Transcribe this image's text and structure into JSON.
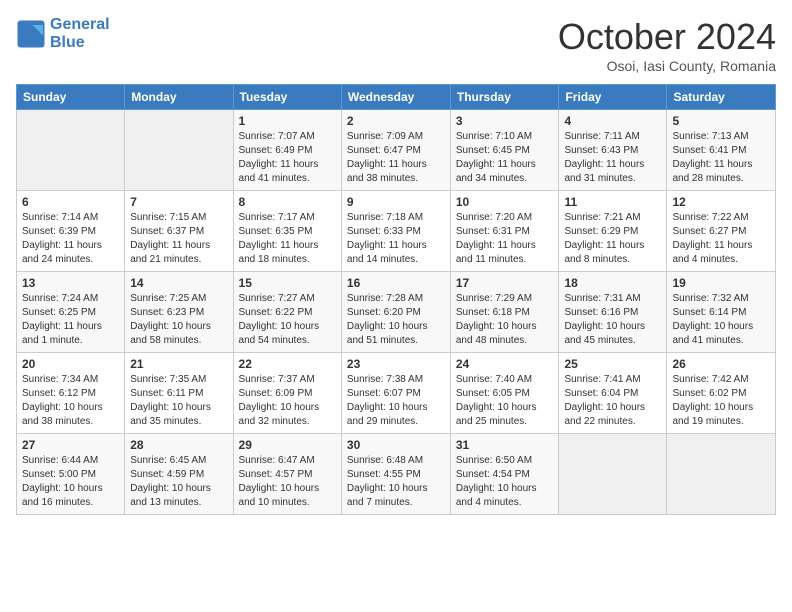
{
  "header": {
    "logo_line1": "General",
    "logo_line2": "Blue",
    "month": "October 2024",
    "location": "Osoi, Iasi County, Romania"
  },
  "weekdays": [
    "Sunday",
    "Monday",
    "Tuesday",
    "Wednesday",
    "Thursday",
    "Friday",
    "Saturday"
  ],
  "weeks": [
    [
      {
        "day": "",
        "info": ""
      },
      {
        "day": "",
        "info": ""
      },
      {
        "day": "1",
        "info": "Sunrise: 7:07 AM\nSunset: 6:49 PM\nDaylight: 11 hours and 41 minutes."
      },
      {
        "day": "2",
        "info": "Sunrise: 7:09 AM\nSunset: 6:47 PM\nDaylight: 11 hours and 38 minutes."
      },
      {
        "day": "3",
        "info": "Sunrise: 7:10 AM\nSunset: 6:45 PM\nDaylight: 11 hours and 34 minutes."
      },
      {
        "day": "4",
        "info": "Sunrise: 7:11 AM\nSunset: 6:43 PM\nDaylight: 11 hours and 31 minutes."
      },
      {
        "day": "5",
        "info": "Sunrise: 7:13 AM\nSunset: 6:41 PM\nDaylight: 11 hours and 28 minutes."
      }
    ],
    [
      {
        "day": "6",
        "info": "Sunrise: 7:14 AM\nSunset: 6:39 PM\nDaylight: 11 hours and 24 minutes."
      },
      {
        "day": "7",
        "info": "Sunrise: 7:15 AM\nSunset: 6:37 PM\nDaylight: 11 hours and 21 minutes."
      },
      {
        "day": "8",
        "info": "Sunrise: 7:17 AM\nSunset: 6:35 PM\nDaylight: 11 hours and 18 minutes."
      },
      {
        "day": "9",
        "info": "Sunrise: 7:18 AM\nSunset: 6:33 PM\nDaylight: 11 hours and 14 minutes."
      },
      {
        "day": "10",
        "info": "Sunrise: 7:20 AM\nSunset: 6:31 PM\nDaylight: 11 hours and 11 minutes."
      },
      {
        "day": "11",
        "info": "Sunrise: 7:21 AM\nSunset: 6:29 PM\nDaylight: 11 hours and 8 minutes."
      },
      {
        "day": "12",
        "info": "Sunrise: 7:22 AM\nSunset: 6:27 PM\nDaylight: 11 hours and 4 minutes."
      }
    ],
    [
      {
        "day": "13",
        "info": "Sunrise: 7:24 AM\nSunset: 6:25 PM\nDaylight: 11 hours and 1 minute."
      },
      {
        "day": "14",
        "info": "Sunrise: 7:25 AM\nSunset: 6:23 PM\nDaylight: 10 hours and 58 minutes."
      },
      {
        "day": "15",
        "info": "Sunrise: 7:27 AM\nSunset: 6:22 PM\nDaylight: 10 hours and 54 minutes."
      },
      {
        "day": "16",
        "info": "Sunrise: 7:28 AM\nSunset: 6:20 PM\nDaylight: 10 hours and 51 minutes."
      },
      {
        "day": "17",
        "info": "Sunrise: 7:29 AM\nSunset: 6:18 PM\nDaylight: 10 hours and 48 minutes."
      },
      {
        "day": "18",
        "info": "Sunrise: 7:31 AM\nSunset: 6:16 PM\nDaylight: 10 hours and 45 minutes."
      },
      {
        "day": "19",
        "info": "Sunrise: 7:32 AM\nSunset: 6:14 PM\nDaylight: 10 hours and 41 minutes."
      }
    ],
    [
      {
        "day": "20",
        "info": "Sunrise: 7:34 AM\nSunset: 6:12 PM\nDaylight: 10 hours and 38 minutes."
      },
      {
        "day": "21",
        "info": "Sunrise: 7:35 AM\nSunset: 6:11 PM\nDaylight: 10 hours and 35 minutes."
      },
      {
        "day": "22",
        "info": "Sunrise: 7:37 AM\nSunset: 6:09 PM\nDaylight: 10 hours and 32 minutes."
      },
      {
        "day": "23",
        "info": "Sunrise: 7:38 AM\nSunset: 6:07 PM\nDaylight: 10 hours and 29 minutes."
      },
      {
        "day": "24",
        "info": "Sunrise: 7:40 AM\nSunset: 6:05 PM\nDaylight: 10 hours and 25 minutes."
      },
      {
        "day": "25",
        "info": "Sunrise: 7:41 AM\nSunset: 6:04 PM\nDaylight: 10 hours and 22 minutes."
      },
      {
        "day": "26",
        "info": "Sunrise: 7:42 AM\nSunset: 6:02 PM\nDaylight: 10 hours and 19 minutes."
      }
    ],
    [
      {
        "day": "27",
        "info": "Sunrise: 6:44 AM\nSunset: 5:00 PM\nDaylight: 10 hours and 16 minutes."
      },
      {
        "day": "28",
        "info": "Sunrise: 6:45 AM\nSunset: 4:59 PM\nDaylight: 10 hours and 13 minutes."
      },
      {
        "day": "29",
        "info": "Sunrise: 6:47 AM\nSunset: 4:57 PM\nDaylight: 10 hours and 10 minutes."
      },
      {
        "day": "30",
        "info": "Sunrise: 6:48 AM\nSunset: 4:55 PM\nDaylight: 10 hours and 7 minutes."
      },
      {
        "day": "31",
        "info": "Sunrise: 6:50 AM\nSunset: 4:54 PM\nDaylight: 10 hours and 4 minutes."
      },
      {
        "day": "",
        "info": ""
      },
      {
        "day": "",
        "info": ""
      }
    ]
  ]
}
